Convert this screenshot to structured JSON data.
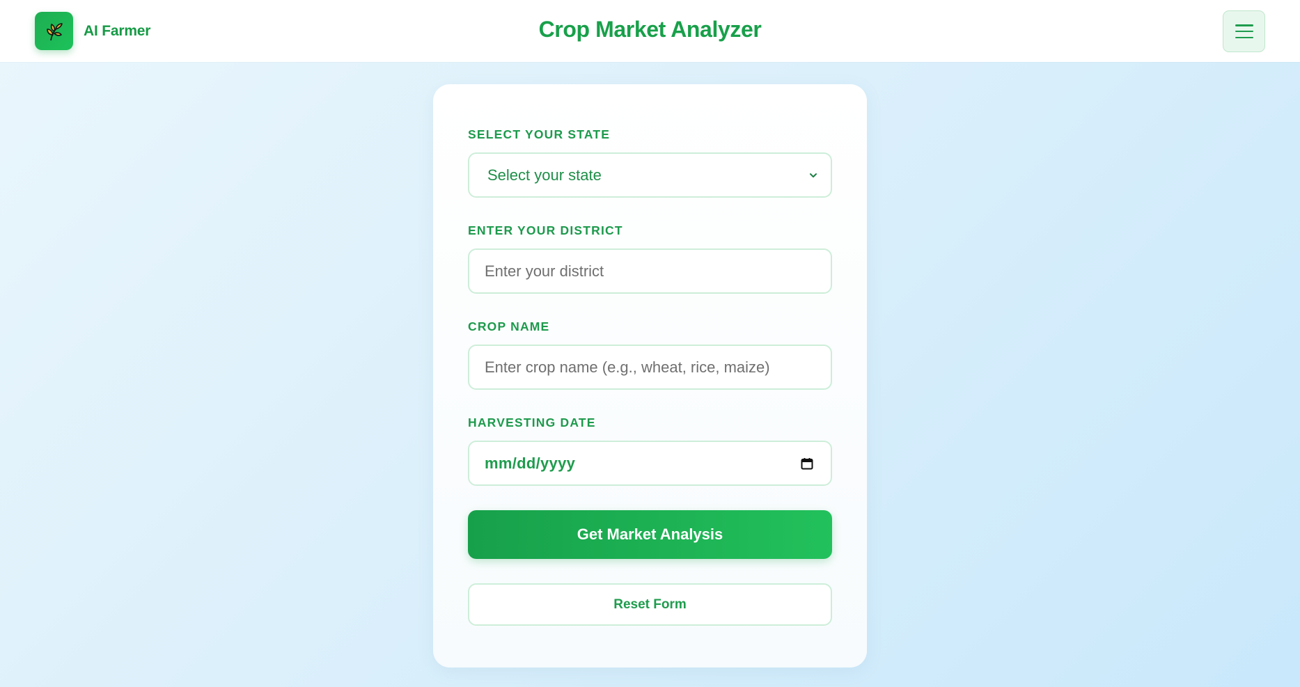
{
  "header": {
    "brand_name": "AI Farmer",
    "brand_icon": "wheat-icon",
    "title": "Crop Market Analyzer",
    "menu_icon": "hamburger-menu-icon"
  },
  "form": {
    "state": {
      "label": "SELECT YOUR STATE",
      "selected_value": "Select your state"
    },
    "district": {
      "label": "ENTER YOUR DISTRICT",
      "placeholder": "Enter your district"
    },
    "crop": {
      "label": "CROP NAME",
      "placeholder": "Enter crop name (e.g., wheat, rice, maize)"
    },
    "harvest_date": {
      "label": "HARVESTING DATE",
      "placeholder": "mm/dd/yyyy",
      "icon": "calendar-icon"
    },
    "submit_label": "Get Market Analysis",
    "reset_label": "Reset Form"
  },
  "colors": {
    "brand_green": "#18a04a",
    "button_gradient_start": "#17a04a",
    "button_gradient_end": "#22c15c",
    "field_border": "#cdeed9",
    "background": "#dcf0fb"
  }
}
